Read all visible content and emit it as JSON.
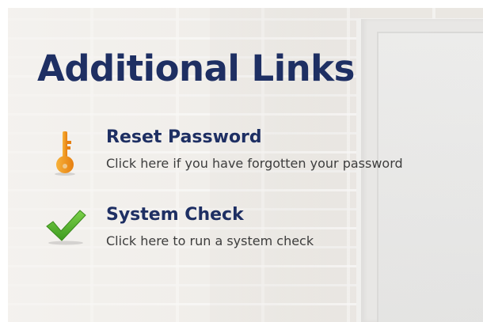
{
  "heading": "Additional Links",
  "links": [
    {
      "title": "Reset Password",
      "description": "Click here if you have forgotten your password",
      "icon": "key-icon"
    },
    {
      "title": "System Check",
      "description": "Click here to run a system check",
      "icon": "checkmark-icon"
    }
  ],
  "colors": {
    "heading": "#1e2f63",
    "link_title": "#1e2f63",
    "description": "#3d3d3d",
    "key_icon": "#f39a1e",
    "check_icon": "#4fae2a"
  }
}
